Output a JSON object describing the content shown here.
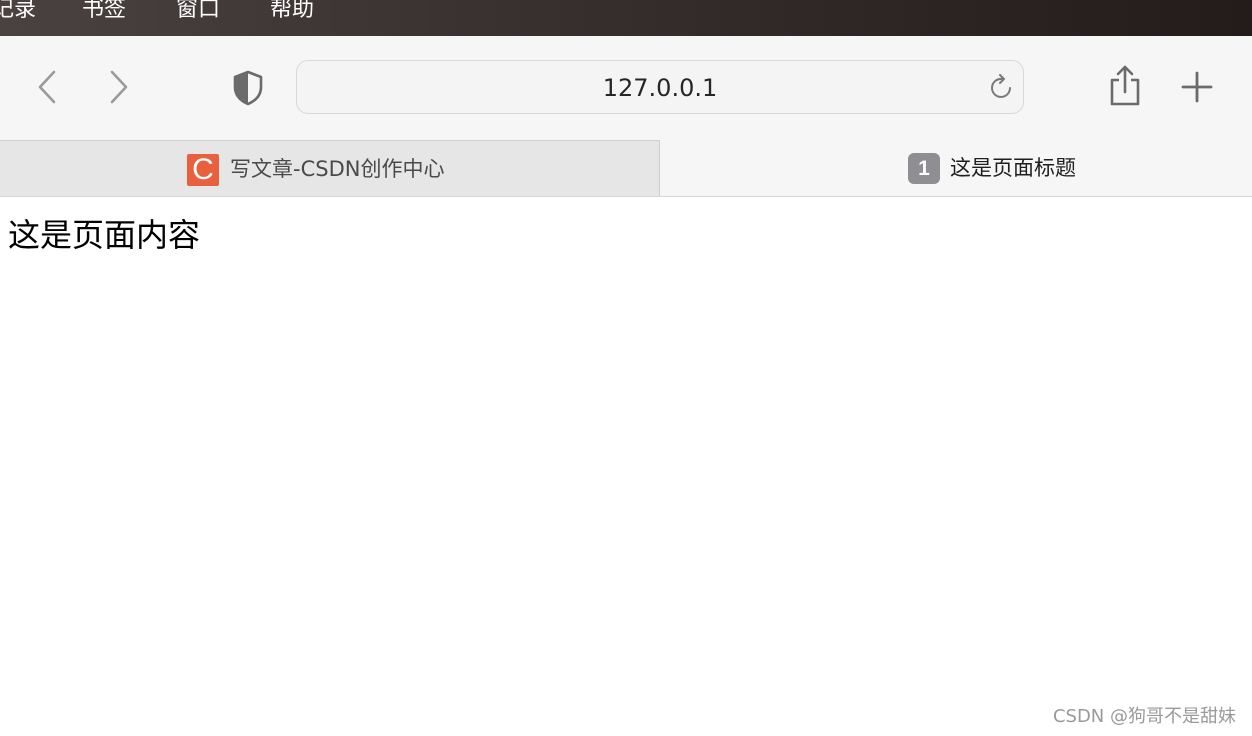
{
  "menubar": {
    "items": [
      "记录",
      "书签",
      "窗口",
      "帮助"
    ]
  },
  "toolbar": {
    "back_icon": "chevron-left-icon",
    "forward_icon": "chevron-right-icon",
    "privacy_icon": "shield-icon",
    "address": "127.0.0.1",
    "reload_icon": "reload-icon",
    "share_icon": "share-icon",
    "new_tab_icon": "plus-icon"
  },
  "tabs": [
    {
      "favicon": "C",
      "favicon_color": "#e9603f",
      "title": "写文章-CSDN创作中心",
      "active": false
    },
    {
      "badge": "1",
      "title": "这是页面标题",
      "active": true
    }
  ],
  "page": {
    "content": "这是页面内容"
  },
  "watermark": "CSDN @狗哥不是甜妹"
}
